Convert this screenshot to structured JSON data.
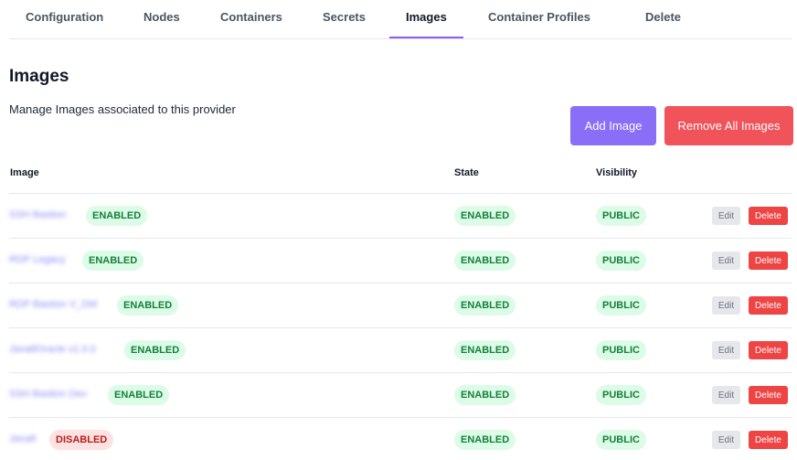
{
  "tabs": [
    {
      "label": "Configuration"
    },
    {
      "label": "Nodes"
    },
    {
      "label": "Containers"
    },
    {
      "label": "Secrets"
    },
    {
      "label": "Images",
      "active": true
    },
    {
      "label": "Container Profiles"
    },
    {
      "label": "Delete"
    }
  ],
  "header": {
    "title": "Images",
    "description": "Manage Images associated to this provider",
    "add_button": "Add Image",
    "remove_all_button": "Remove All Images"
  },
  "table": {
    "columns": [
      "Image",
      "State",
      "Visibility"
    ],
    "edit_label": "Edit",
    "delete_label": "Delete",
    "rows": [
      {
        "name": "SSH Bastion",
        "status": "ENABLED",
        "state": "ENABLED",
        "visibility": "PUBLIC"
      },
      {
        "name": "RDP Legacy",
        "status": "ENABLED",
        "state": "ENABLED",
        "visibility": "PUBLIC"
      },
      {
        "name": "RDP Bastion V_DM",
        "status": "ENABLED",
        "state": "ENABLED",
        "visibility": "PUBLIC"
      },
      {
        "name": "Java8Oracle v1.0.0",
        "status": "ENABLED",
        "state": "ENABLED",
        "visibility": "PUBLIC"
      },
      {
        "name": "SSH Bastion Dev",
        "status": "ENABLED",
        "state": "ENABLED",
        "visibility": "PUBLIC"
      },
      {
        "name": "Java8",
        "status": "DISABLED",
        "state": "ENABLED",
        "visibility": "PUBLIC"
      }
    ]
  },
  "colors": {
    "accent": "#8b6ef7",
    "danger": "#f0535a",
    "badge_green_bg": "#dcfce7",
    "badge_green_text": "#15803d",
    "badge_red_bg": "#fee2e2",
    "badge_red_text": "#b91c1c"
  }
}
